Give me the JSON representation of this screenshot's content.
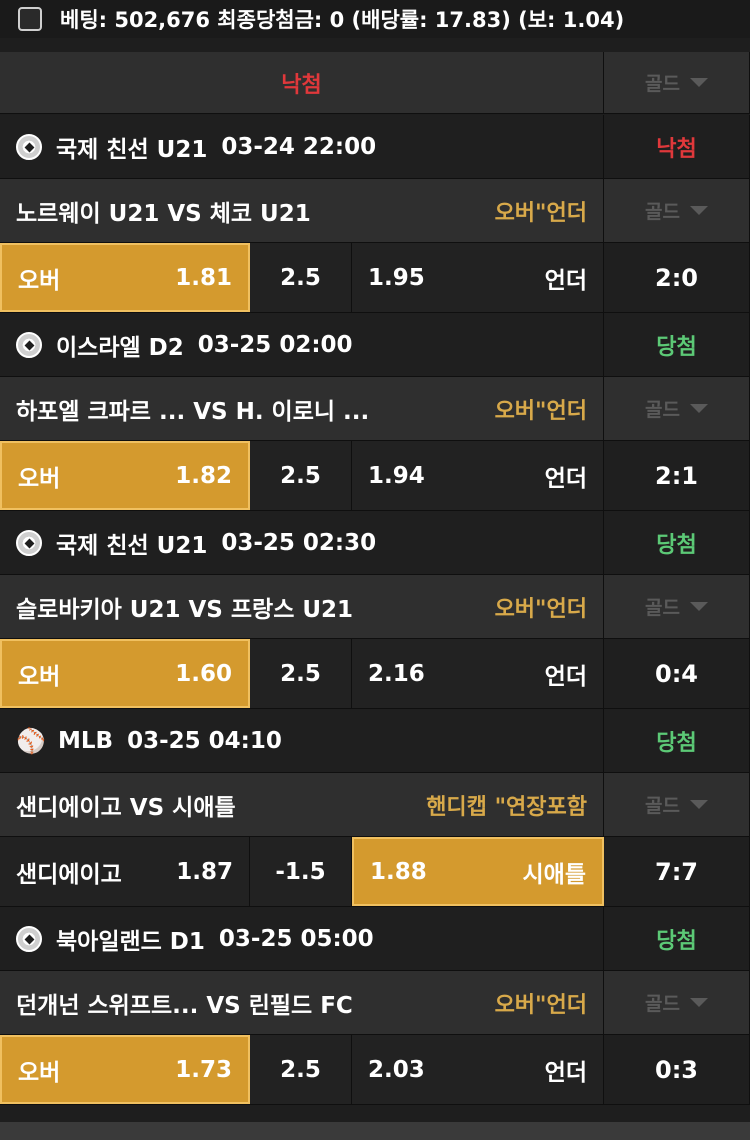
{
  "header": {
    "summary": "베팅: 502,676 최종당첨금: 0 (배당률: 17.83) (보: 1.04)"
  },
  "overall": {
    "result": "낙첨",
    "gold_label": "골드"
  },
  "games": [
    {
      "sport_icon": "soccer-ball-icon",
      "league": "국제 친선 U21",
      "datetime": "03-24 22:00",
      "result": "낙첨",
      "result_type": "lose",
      "teams": "노르웨이 U21 VS 체코 U21",
      "bet_type": "오버\"언더",
      "gold_label": "골드",
      "home_label": "오버",
      "home_odds": "1.81",
      "line": "2.5",
      "away_odds": "1.95",
      "away_label": "언더",
      "score": "2:0",
      "picked": "home"
    },
    {
      "sport_icon": "soccer-ball-icon",
      "league": "이스라엘 D2",
      "datetime": "03-25 02:00",
      "result": "당첨",
      "result_type": "win",
      "teams": "하포엘 크파르 ...    VS H. 이로니 ...",
      "bet_type": "오버\"언더",
      "gold_label": "골드",
      "home_label": "오버",
      "home_odds": "1.82",
      "line": "2.5",
      "away_odds": "1.94",
      "away_label": "언더",
      "score": "2:1",
      "picked": "home"
    },
    {
      "sport_icon": "soccer-ball-icon",
      "league": "국제 친선 U21",
      "datetime": "03-25 02:30",
      "result": "당첨",
      "result_type": "win",
      "teams": "슬로바키아 U21 VS 프랑스 U21",
      "bet_type": "오버\"언더",
      "gold_label": "골드",
      "home_label": "오버",
      "home_odds": "1.60",
      "line": "2.5",
      "away_odds": "2.16",
      "away_label": "언더",
      "score": "0:4",
      "picked": "home"
    },
    {
      "sport_icon": "baseball-bat-icon",
      "league": "MLB",
      "datetime": "03-25 04:10",
      "result": "당첨",
      "result_type": "win",
      "teams": "샌디에이고 VS 시애틀",
      "bet_type": "핸디캡 \"연장포함",
      "gold_label": "골드",
      "home_label": "샌디에이고",
      "home_odds": "1.87",
      "line": "-1.5",
      "away_odds": "1.88",
      "away_label": "시애틀",
      "score": "7:7",
      "picked": "away"
    },
    {
      "sport_icon": "soccer-ball-icon",
      "league": "북아일랜드 D1",
      "datetime": "03-25 05:00",
      "result": "당첨",
      "result_type": "win",
      "teams": "던개넌 스위프트...  VS 린필드 FC",
      "bet_type": "오버\"언더",
      "gold_label": "골드",
      "home_label": "오버",
      "home_odds": "1.73",
      "line": "2.5",
      "away_odds": "2.03",
      "away_label": "언더",
      "score": "0:3",
      "picked": "home"
    }
  ]
}
